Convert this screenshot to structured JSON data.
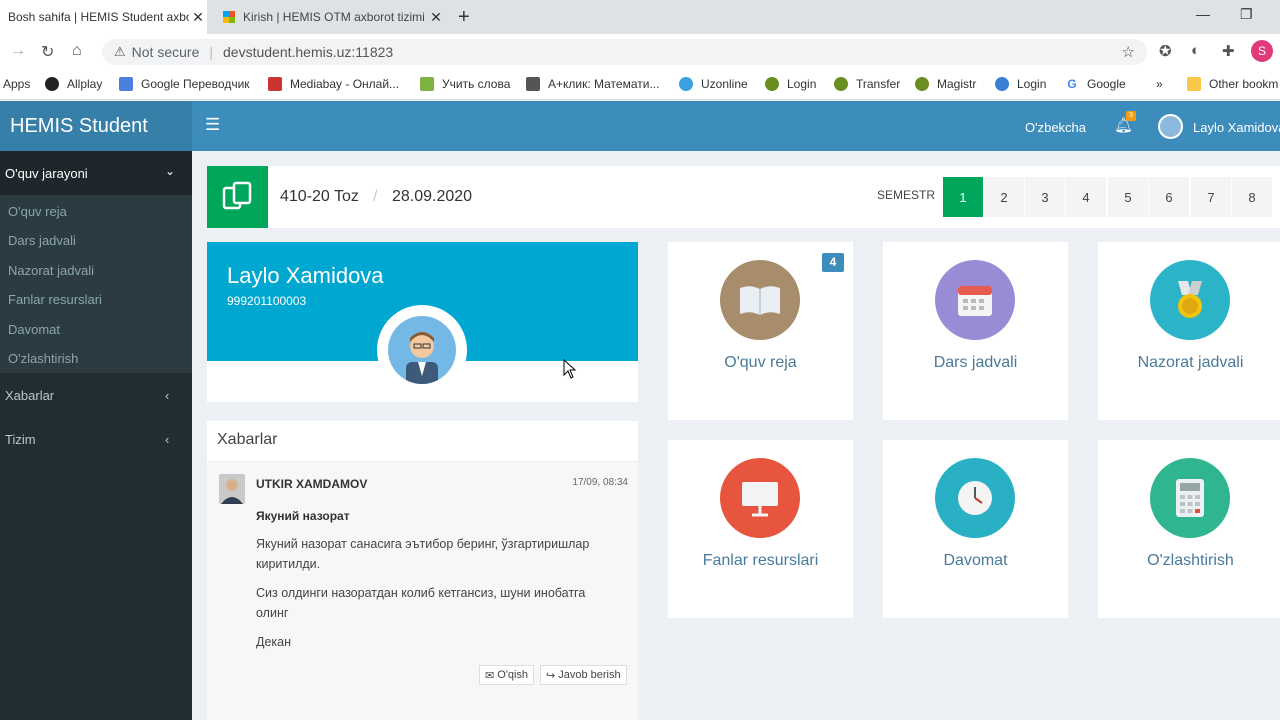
{
  "browser": {
    "tabs": [
      {
        "title": "Bosh sahifa | HEMIS Student axborot tizimi",
        "active": true
      },
      {
        "title": "Kirish | HEMIS OTM axborot tizimi",
        "active": false
      }
    ],
    "address": {
      "warning": "Not secure",
      "url": "devstudent.hemis.uz:11823"
    },
    "profile_initial": "S",
    "bookmarks": [
      "Apps",
      "Allplay",
      "Google Переводчик",
      "Mediabay - Онлай...",
      "Учить слова",
      "А+клик: Математи...",
      "Uzonline",
      "Login",
      "Transfer",
      "Magistr",
      "Login",
      "Google",
      "»",
      "Other bookm"
    ]
  },
  "header": {
    "logo": "HEMIS Student",
    "language": "O'zbekcha",
    "notification_count": "3",
    "user_name": "Laylo Xamidova"
  },
  "sidebar": {
    "section_title": "O'quv jarayoni",
    "sub_items": [
      "O'quv reja",
      "Dars jadvali",
      "Nazorat jadvali",
      "Fanlar resurslari",
      "Davomat",
      "O'zlashtirish"
    ],
    "top_items": [
      "Xabarlar",
      "Tizim"
    ]
  },
  "main": {
    "group": "410-20 Toz",
    "date": "28.09.2020",
    "semester_label": "SEMESTR",
    "semesters": [
      "1",
      "2",
      "3",
      "4",
      "5",
      "6",
      "7",
      "8"
    ],
    "active_semester": "1"
  },
  "profile": {
    "name": "Laylo Xamidova",
    "id": "999201100003"
  },
  "tiles": [
    {
      "label": "O'quv reja",
      "color": "#a88d6d",
      "badge": "4",
      "icon": "book-icon"
    },
    {
      "label": "Dars jadvali",
      "color": "#9a8bd6",
      "icon": "calendar-icon"
    },
    {
      "label": "Nazorat jadvali",
      "color": "#2bb3c8",
      "icon": "medal-icon"
    },
    {
      "label": "Fanlar resurslari",
      "color": "#e8553e",
      "icon": "presentation-icon"
    },
    {
      "label": "Davomat",
      "color": "#2ab0c5",
      "icon": "clock-icon"
    },
    {
      "label": "O'zlashtirish",
      "color": "#2fb58f",
      "icon": "calculator-icon"
    }
  ],
  "news": {
    "title": "Xabarlar",
    "item": {
      "author": "UTKIR XAMDAMOV",
      "time": "17/09, 08:34",
      "subject": "Якуний назорат",
      "paragraphs": [
        "Якуний назорат санасига эътибор беринг, ўзгартиришлар киритилди.",
        "Сиз олдинги назоратдан колиб кетгансиз, шуни инобатга олинг",
        "Декан"
      ],
      "read_label": "O'qish",
      "reply_label": "Javob berish"
    }
  }
}
